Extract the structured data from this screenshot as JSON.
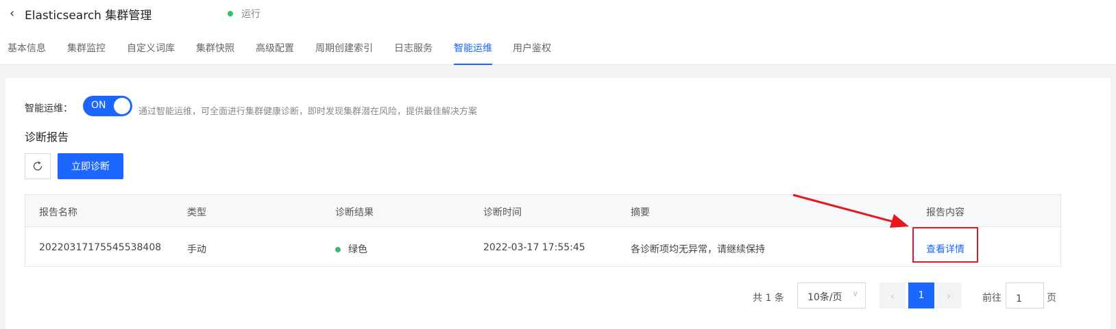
{
  "header": {
    "title": "Elasticsearch 集群管理",
    "status": "运行",
    "status_color": "#2bc26b"
  },
  "tabs": [
    {
      "label": "基本信息",
      "active": false
    },
    {
      "label": "集群监控",
      "active": false
    },
    {
      "label": "自定义词库",
      "active": false
    },
    {
      "label": "集群快照",
      "active": false
    },
    {
      "label": "高级配置",
      "active": false
    },
    {
      "label": "周期创建索引",
      "active": false
    },
    {
      "label": "日志服务",
      "active": false
    },
    {
      "label": "智能运维",
      "active": true
    },
    {
      "label": "用户鉴权",
      "active": false
    }
  ],
  "aiops": {
    "label": "智能运维：",
    "toggle_text": "ON",
    "description": "通过智能运维，可全面进行集群健康诊断，即时发现集群潜在风险，提供最佳解决方案"
  },
  "report": {
    "section_title": "诊断报告",
    "diagnose_button": "立即诊断",
    "columns": [
      "报告名称",
      "类型",
      "诊断结果",
      "诊断时间",
      "摘要",
      "报告内容"
    ],
    "rows": [
      {
        "name": "20220317175545538408",
        "type": "手动",
        "result": "绿色",
        "time": "2022-03-17 17:55:45",
        "summary": "各诊断项均无异常，请继续保持",
        "action": "查看详情"
      }
    ]
  },
  "pagination": {
    "total": "共 1 条",
    "page_size": "10条/页",
    "current_page": "1",
    "goto_label": "前往",
    "goto_value": "1",
    "goto_unit": "页"
  },
  "colors": {
    "accent": "#1a66ff",
    "annotation": "#e8161f"
  }
}
